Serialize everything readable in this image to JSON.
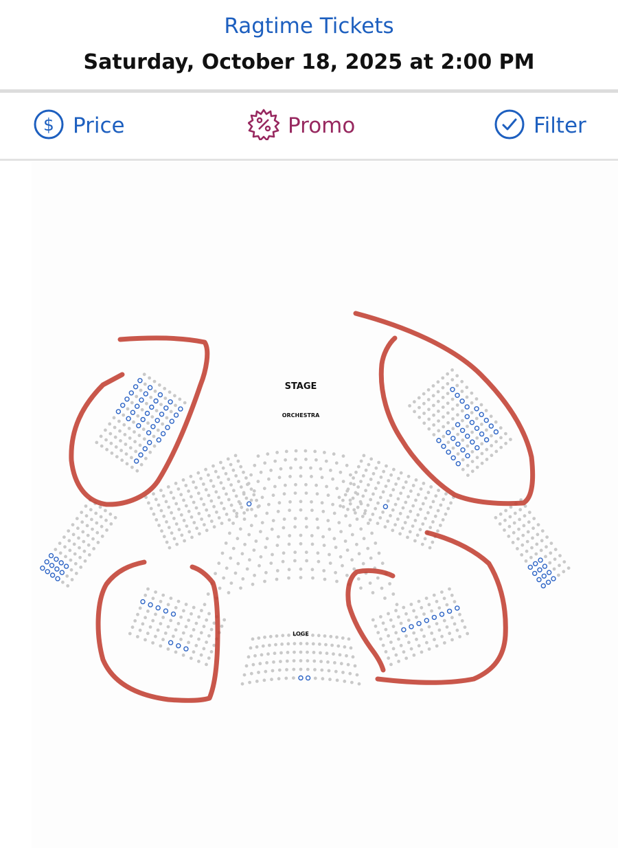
{
  "header": {
    "title": "Ragtime Tickets",
    "date": "Saturday, October 18, 2025 at 2:00 PM"
  },
  "toolbar": {
    "price_label": "Price",
    "promo_label": "Promo",
    "filter_label": "Filter"
  },
  "seat_map": {
    "stage_label": "STAGE",
    "orchestra_label": "ORCHESTRA",
    "loge_label": "LOGE"
  },
  "colors": {
    "accent_blue": "#1d5fbf",
    "promo_purple": "#97285f",
    "seat_unavailable": "#c9c9c9",
    "seat_available": "#2a62c4",
    "annotation_red": "#c0392b"
  },
  "icons": {
    "price": "dollar-circle-icon",
    "promo": "percent-badge-icon",
    "filter": "check-circle-icon"
  }
}
